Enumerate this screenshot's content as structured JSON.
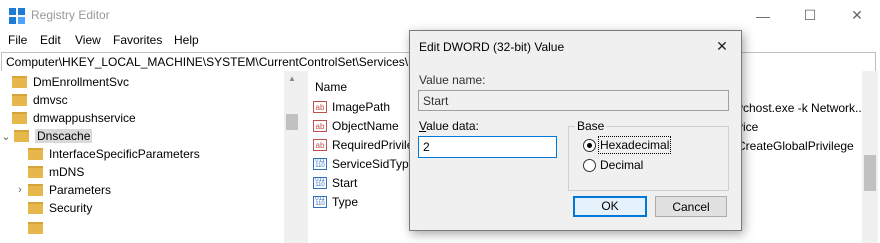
{
  "window": {
    "title": "Registry Editor",
    "controls": {
      "minimize": "—",
      "maximize": "☐",
      "close": "✕"
    }
  },
  "menu": [
    "File",
    "Edit",
    "View",
    "Favorites",
    "Help"
  ],
  "address": "Computer\\HKEY_LOCAL_MACHINE\\SYSTEM\\CurrentControlSet\\Services\\Dn",
  "tree": {
    "items": [
      {
        "label": "DmEnrollmentSvc"
      },
      {
        "label": "dmvsc"
      },
      {
        "label": "dmwappushservice"
      },
      {
        "label": "Dnscache",
        "expander": "⌄"
      },
      {
        "label": "InterfaceSpecificParameters"
      },
      {
        "label": "mDNS"
      },
      {
        "label": "Parameters",
        "expander": "›"
      },
      {
        "label": "Security"
      }
    ]
  },
  "list": {
    "column_name": "Name",
    "rows": [
      {
        "name": "ImagePath",
        "icon": "string-value-icon"
      },
      {
        "name": "ObjectName",
        "icon": "string-value-icon"
      },
      {
        "name": "RequiredPrivile",
        "icon": "string-value-icon"
      },
      {
        "name": "ServiceSidType",
        "icon": "binary-value-icon"
      },
      {
        "name": "Start",
        "icon": "binary-value-icon"
      },
      {
        "name": "Type",
        "icon": "binary-value-icon"
      }
    ],
    "data_fragments": [
      "vchost.exe -k Network...",
      "vice",
      "CreateGlobalPrivilege"
    ]
  },
  "dialog": {
    "title": "Edit DWORD (32-bit) Value",
    "close": "✕",
    "value_name_label": "Value name:",
    "value_name": "Start",
    "value_data_label": "Value data:",
    "value_data": "2",
    "base_label": "Base",
    "radio_hex": "Hexadecimal",
    "radio_dec": "Decimal",
    "ok_label": "OK",
    "cancel_label": "Cancel"
  }
}
